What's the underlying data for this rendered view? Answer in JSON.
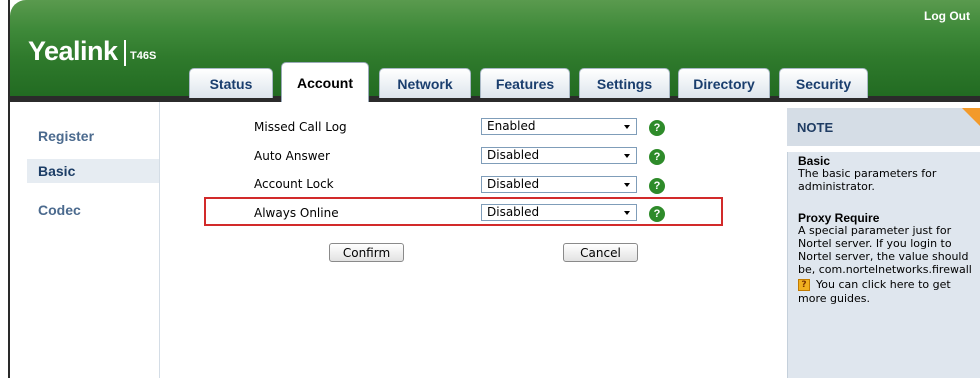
{
  "header": {
    "logo": "Yealink",
    "model": "T46S",
    "logout": "Log Out"
  },
  "tabs": [
    {
      "label": "Status"
    },
    {
      "label": "Account"
    },
    {
      "label": "Network"
    },
    {
      "label": "Features"
    },
    {
      "label": "Settings"
    },
    {
      "label": "Directory"
    },
    {
      "label": "Security"
    }
  ],
  "active_tab": "Account",
  "sidebar": {
    "items": [
      {
        "label": "Register"
      },
      {
        "label": "Basic"
      },
      {
        "label": "Codec"
      }
    ],
    "selected": "Basic"
  },
  "form": {
    "rows": [
      {
        "label": "Missed Call Log",
        "value": "Enabled"
      },
      {
        "label": "Auto Answer",
        "value": "Disabled"
      },
      {
        "label": "Account Lock",
        "value": "Disabled"
      },
      {
        "label": "Always Online",
        "value": "Disabled"
      }
    ],
    "help_glyph": "?",
    "confirm": "Confirm",
    "cancel": "Cancel"
  },
  "note": {
    "title": "NOTE",
    "sections": [
      {
        "title": "Basic",
        "text": "The basic parameters for administrator."
      },
      {
        "title": "Proxy Require",
        "text": "A special parameter just for Nortel server. If you login to Nortel server, the value should be, com.nortelnetworks.firewall"
      }
    ],
    "guide_icon": "?",
    "guide_text": "You can click here to get more guides."
  },
  "colors": {
    "header_green": "#2f7a2c",
    "tab_text": "#1a3e6e",
    "highlight": "#d22a2a",
    "help_green": "#2e8b2a",
    "note_bg": "#dfe6ee"
  }
}
